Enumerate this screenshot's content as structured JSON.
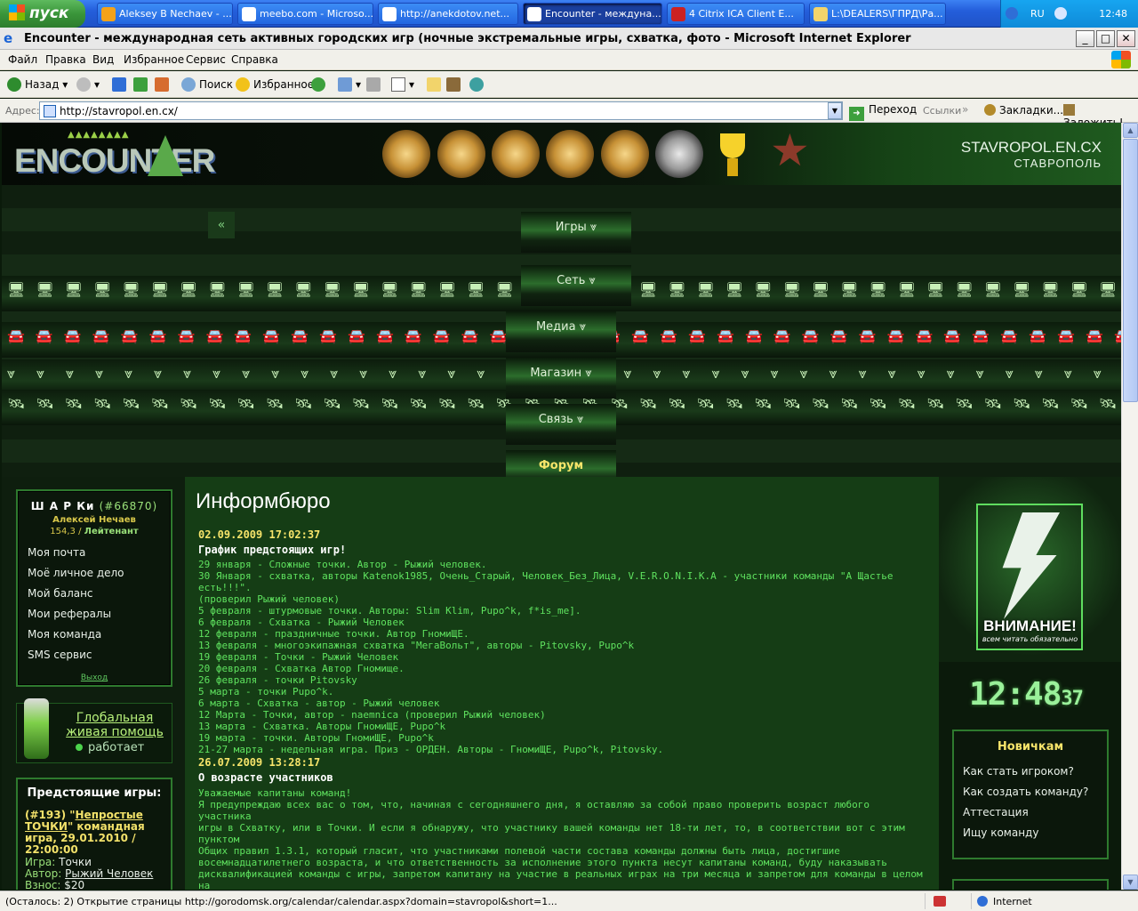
{
  "taskbar": {
    "start_label": "пуск",
    "tasks": [
      {
        "label": "Aleksey B Nechaev - ...",
        "icon": "meebo-icon"
      },
      {
        "label": "meebo.com - Microso...",
        "icon": "ie-icon"
      },
      {
        "label": "http://anekdotov.net...",
        "icon": "ie-icon"
      },
      {
        "label": "Encounter - междуна...",
        "icon": "ie-icon",
        "active": true
      },
      {
        "label": "4 Citrix ICA Client E...",
        "icon": "citrix-icon"
      },
      {
        "label": "L:\\DEALERS\\ГПРД\\Ра...",
        "icon": "folder-icon"
      }
    ],
    "tray": {
      "lang": "RU",
      "time": "12:48"
    }
  },
  "window": {
    "title": "Encounter - международная сеть активных городских игр (ночные экстремальные игры, схватка, фото - Microsoft Internet Explorer",
    "buttons": {
      "minimize": "_",
      "maximize": "□",
      "close": "✕"
    }
  },
  "menubar": [
    "Файл",
    "Правка",
    "Вид",
    "Избранное",
    "Сервис",
    "Справка"
  ],
  "toolbar": {
    "back": "Назад",
    "search": "Поиск",
    "favorites": "Избранное"
  },
  "addressbar": {
    "label": "Адрес:",
    "url": "http://stavropol.en.cx/",
    "go": "Переход",
    "links": "Ссылки",
    "bookmarks": "Закладки...",
    "bookmark_it": "Заложить!"
  },
  "site": {
    "logo_text": "ENCOUNTER",
    "domain": "STAVROPOL.EN.CX",
    "city": "СТАВРОПОЛЬ"
  },
  "nav": {
    "back_arrow": "«",
    "items": [
      {
        "label": "Игры ⩔"
      },
      {
        "label": "Сеть ⩔"
      },
      {
        "label": "Медиа ⩔"
      },
      {
        "label": "Магазин ⩔"
      },
      {
        "label": "Связь ⩔"
      },
      {
        "label": "Форум"
      }
    ]
  },
  "user": {
    "nick": "Ш А Р Ки",
    "id": "(#66870)",
    "fullname": "Алексей Нечаев",
    "points": "154,3 /",
    "rank": "Лейтенант",
    "menu": [
      "Моя почта",
      "Моё личное дело",
      "Мой баланс",
      "Мои рефералы",
      "Моя команда",
      "SMS сервис"
    ],
    "logout": "Выход"
  },
  "help": {
    "title": "Глобальная живая помощь",
    "status": "работает"
  },
  "upcoming": {
    "title": "Предстоящие игры:",
    "game_num": "(#193) \"",
    "game_name": "Непростые ТОЧКИ",
    "game_tail": "\" командная игра, 29.01.2010 / 22:00:00",
    "type_label": "Игра:",
    "type_value": "Точки",
    "author_label": "Автор:",
    "author_value": "Рыжий Человек",
    "fee_label": "Взнос:",
    "fee_value": "$20"
  },
  "content": {
    "page_title": "Информбюро",
    "news": [
      {
        "date": "02.09.2009 17:02:37",
        "title": "График предстоящих игр!",
        "text": "29 января - Сложные точки. Автор - Рыжий человек.\n30 Января - схватка, авторы Katenok1985, Очень_Старый, Человек_Без_Лица, V.E.R.O.N.I.K.A - участники команды \"А Щастье есть!!!\".\n(проверил Рыжий человек)\n5 февраля - штурмовые точки. Авторы: Slim Klim, Pupo^k, f*is_me].\n6 февраля - Схватка - Рыжий Человек\n12 февраля - праздничные точки. Автор ГномиЩЕ.\n13 февраля - многоэкипажная схватка \"МегаВольт\", авторы - Pitovsky, Pupo^k\n19 февраля - Точки - Рыжий Человек\n20 февраля - Схватка Автор Гномище.\n26 февраля - точки Pitovsky\n5 марта - точки Pupo^k.\n6 марта - Схватка - автор - Рыжий человек\n12 Марта - Точки, автор - naemnica (проверил Рыжий человек)\n13 марта - Схватка. Авторы ГномиЩЕ, Pupo^k\n19 марта - точки. Авторы ГномиЩЕ, Pupo^k\n21-27 марта - недельная игра. Приз - ОРДЕН. Авторы - ГномиЩЕ, Pupo^k, Pitovsky."
      },
      {
        "date": "26.07.2009 13:28:17",
        "title": "О возрасте участников",
        "text": "Уважаемые капитаны команд!\nЯ предупреждаю всех вас о том, что, начиная с сегодняшнего дня, я оставляю за собой право проверить возраст любого участника\nигры в Схватку, или в Точки. И если я обнаружу, что участнику вашей команды нет 18-ти лет, то, в соответствии вот с этим пунктом\nОбщих правил 1.3.1, который гласит, что участниками полевой части состава команды должны быть лица, достигшие\nвосемнадцатилетнего возраста, и что ответственность за исполнение этого пункта несут капитаны команд, буду наказывать\nдисквалификацией команды с игры, запретом капитану на участие в реальных играх на три месяца и запретом для команды в целом на\nучастие в играх на месяц. Исключений не будет никаких и ни для кого."
      }
    ]
  },
  "right": {
    "warning": "ВНИМАНИЕ!",
    "warning_sub": "всем читать обязательно",
    "clock": "12:48",
    "clock_sec": "37",
    "newbie_title": "Новичкам",
    "newbie_links": [
      "Как стать игроком?",
      "Как создать команду?",
      "Аттестация",
      "Ищу команду"
    ]
  },
  "statusbar": {
    "text": "(Осталось: 2) Открытие страницы http://gorodomsk.org/calendar/calendar.aspx?domain=stavropol&short=1...",
    "zone": "Internet"
  }
}
